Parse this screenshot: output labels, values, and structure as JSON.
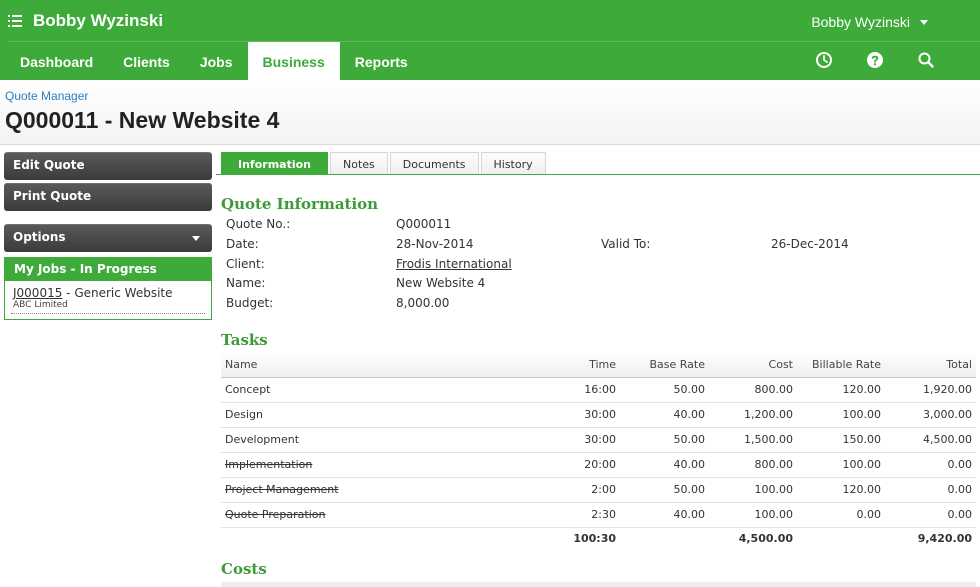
{
  "header": {
    "app_name": "Bobby Wyzinski",
    "user_menu": "Bobby Wyzinski",
    "nav": [
      {
        "label": "Dashboard",
        "active": false
      },
      {
        "label": "Clients",
        "active": false
      },
      {
        "label": "Jobs",
        "active": false
      },
      {
        "label": "Business",
        "active": true
      },
      {
        "label": "Reports",
        "active": false
      }
    ],
    "icons": [
      "clock-icon",
      "help-icon",
      "search-icon"
    ],
    "accent_color": "#3daa3a"
  },
  "page": {
    "breadcrumb": "Quote Manager",
    "title": "Q000011 - New Website 4"
  },
  "sidebar": {
    "edit_quote": "Edit Quote",
    "print_quote": "Print Quote",
    "options": "Options",
    "jobs_heading": "My Jobs - In Progress",
    "job": {
      "number": "J000015",
      "separator": " - ",
      "name": "Generic Website",
      "client": "ABC Limited"
    }
  },
  "tabs": [
    {
      "label": "Information",
      "active": true
    },
    {
      "label": "Notes",
      "active": false
    },
    {
      "label": "Documents",
      "active": false
    },
    {
      "label": "History",
      "active": false
    }
  ],
  "quote_info": {
    "heading": "Quote Information",
    "quote_no_label": "Quote No.:",
    "quote_no": "Q000011",
    "date_label": "Date:",
    "date": "28-Nov-2014",
    "valid_to_label": "Valid To:",
    "valid_to": "26-Dec-2014",
    "client_label": "Client:",
    "client": "Frodis International",
    "name_label": "Name:",
    "name": "New Website 4",
    "budget_label": "Budget:",
    "budget": "8,000.00"
  },
  "tasks": {
    "heading": "Tasks",
    "columns": [
      "Name",
      "Time",
      "Base Rate",
      "Cost",
      "Billable Rate",
      "Total"
    ],
    "rows": [
      {
        "name": "Concept",
        "time": "16:00",
        "base_rate": "50.00",
        "cost": "800.00",
        "billable_rate": "120.00",
        "total": "1,920.00",
        "struck": false
      },
      {
        "name": "Design",
        "time": "30:00",
        "base_rate": "40.00",
        "cost": "1,200.00",
        "billable_rate": "100.00",
        "total": "3,000.00",
        "struck": false
      },
      {
        "name": "Development",
        "time": "30:00",
        "base_rate": "50.00",
        "cost": "1,500.00",
        "billable_rate": "150.00",
        "total": "4,500.00",
        "struck": false
      },
      {
        "name": "Implementation",
        "time": "20:00",
        "base_rate": "40.00",
        "cost": "800.00",
        "billable_rate": "100.00",
        "total": "0.00",
        "struck": true
      },
      {
        "name": "Project Management",
        "time": "2:00",
        "base_rate": "50.00",
        "cost": "100.00",
        "billable_rate": "120.00",
        "total": "0.00",
        "struck": true
      },
      {
        "name": "Quote Preparation",
        "time": "2:30",
        "base_rate": "40.00",
        "cost": "100.00",
        "billable_rate": "0.00",
        "total": "0.00",
        "struck": true
      }
    ],
    "totals": {
      "time": "100:30",
      "cost": "4,500.00",
      "total": "9,420.00"
    }
  },
  "costs": {
    "heading": "Costs"
  }
}
